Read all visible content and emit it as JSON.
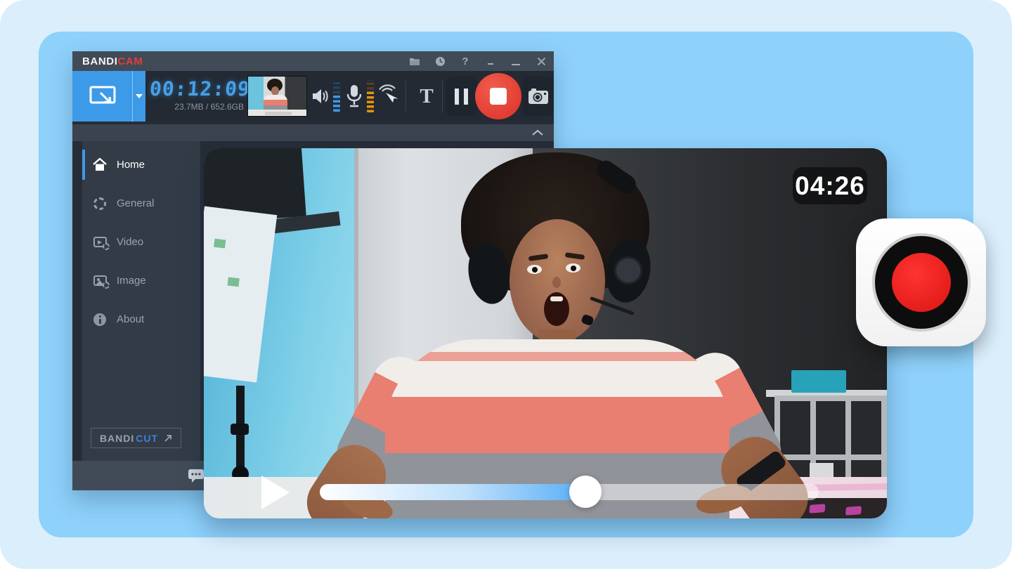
{
  "colors": {
    "accent_blue": "#3D9AE8",
    "record_red": "#E23B31",
    "brand_red": "#E23D3D",
    "timer_blue": "#46A0E9",
    "meter_orange": "#E8930A",
    "bandicut_blue": "#3F7FD9",
    "progress_blue": "#57AEF5",
    "toolbar_dark": "#232A33",
    "titlebar_slate": "#414B57",
    "page_blue": "#8ED1FB"
  },
  "bandicam": {
    "titlebar": {
      "brand_left": "BANDI",
      "brand_right": "CAM",
      "help_label": "?"
    },
    "toolbar": {
      "timer": "00:12:09",
      "storage": "23.7MB / 652.6GB",
      "text_tool_label": "T"
    },
    "sidebar": {
      "items": [
        {
          "label": "Home",
          "active": true
        },
        {
          "label": "General",
          "active": false
        },
        {
          "label": "Video",
          "active": false
        },
        {
          "label": "Image",
          "active": false
        },
        {
          "label": "About",
          "active": false
        }
      ],
      "bandicut": {
        "brand_left": "BANDI",
        "brand_right": "CUT"
      }
    }
  },
  "player": {
    "timestamp": "04:26",
    "progress_percent": 53
  },
  "icons": {
    "titlebar": [
      "folder-icon",
      "clock-icon",
      "help-icon",
      "minimize-tray-icon",
      "minimize-icon",
      "close-icon"
    ],
    "toolbar": [
      "record-area-icon",
      "dropdown-chevron-icon",
      "webcam-preview",
      "speaker-icon",
      "speaker-level-meter",
      "mic-icon",
      "mic-level-meter",
      "mouse-click-icon",
      "text-overlay-icon",
      "pause-icon",
      "stop-record-icon",
      "camera-icon"
    ],
    "sidebar": [
      "home-icon",
      "gear-icon",
      "video-settings-icon",
      "image-settings-icon",
      "about-icon",
      "external-link-icon"
    ],
    "statusbar": [
      "chat-icon"
    ],
    "player": [
      "play-icon",
      "progress-handle"
    ],
    "badge": [
      "bandicam-app-icon"
    ]
  }
}
